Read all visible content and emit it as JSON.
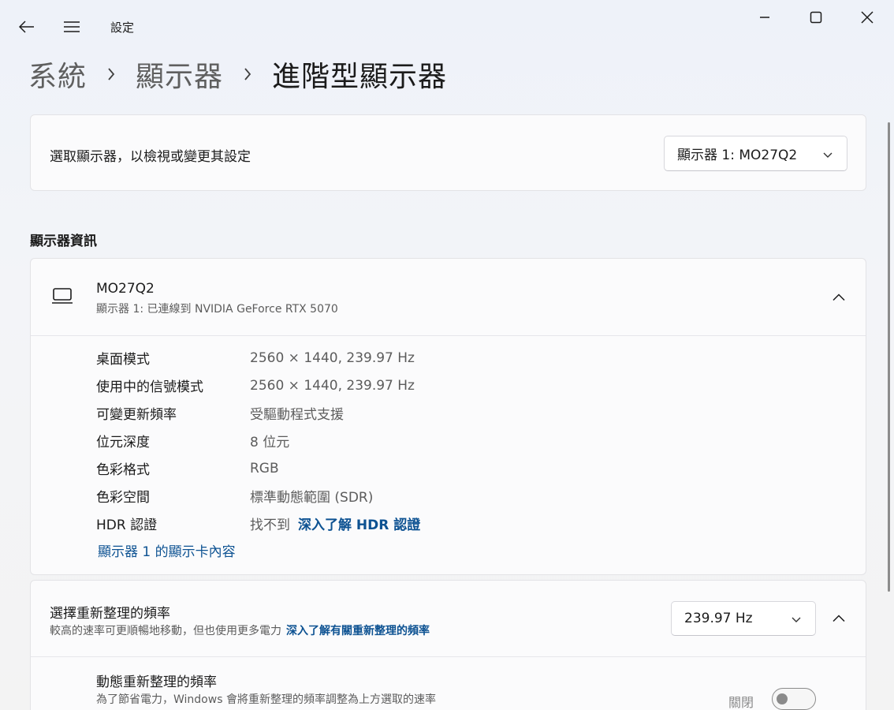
{
  "window": {
    "app_title": "設定",
    "icons": {
      "back": "back-arrow-icon",
      "menu": "hamburger-menu-icon",
      "minimize": "minimize-icon",
      "maximize": "maximize-icon",
      "close": "close-icon"
    }
  },
  "breadcrumb": {
    "items": [
      {
        "label": "系統"
      },
      {
        "label": "顯示器"
      },
      {
        "label": "進階型顯示器"
      }
    ]
  },
  "monitor_select": {
    "label": "選取顯示器，以檢視或變更其設定",
    "selected": "顯示器 1: MO27Q2"
  },
  "display_info": {
    "section_title": "顯示器資訊",
    "monitor_name": "MO27Q2",
    "connection": "顯示器 1: 已連線到 NVIDIA GeForce RTX 5070",
    "rows": [
      {
        "key": "桌面模式",
        "value": "2560 × 1440, 239.97 Hz"
      },
      {
        "key": "使用中的信號模式",
        "value": "2560 × 1440, 239.97 Hz"
      },
      {
        "key": "可變更新頻率",
        "value": "受驅動程式支援"
      },
      {
        "key": "位元深度",
        "value": "8 位元"
      },
      {
        "key": "色彩格式",
        "value": "RGB"
      },
      {
        "key": "色彩空間",
        "value": "標準動態範圍 (SDR)"
      },
      {
        "key": "HDR 認證",
        "value": "找不到",
        "link": "深入了解 HDR 認證"
      }
    ],
    "adapter_link": "顯示器 1 的顯示卡內容"
  },
  "refresh_rate": {
    "title": "選擇重新整理的頻率",
    "description": "較高的速率可更順暢地移動，但也使用更多電力",
    "learn_link": "深入了解有關重新整理的頻率",
    "selected": "239.97 Hz",
    "dynamic": {
      "title": "動態重新整理的頻率",
      "description": "為了節省電力，Windows 會將重新整理的頻率調整為上方選取的速率",
      "state_label": "關閉",
      "enabled": false
    }
  },
  "colors": {
    "accent_link": "#0d5292",
    "background": "#f3f3f3",
    "card": "#fbfbfc"
  }
}
